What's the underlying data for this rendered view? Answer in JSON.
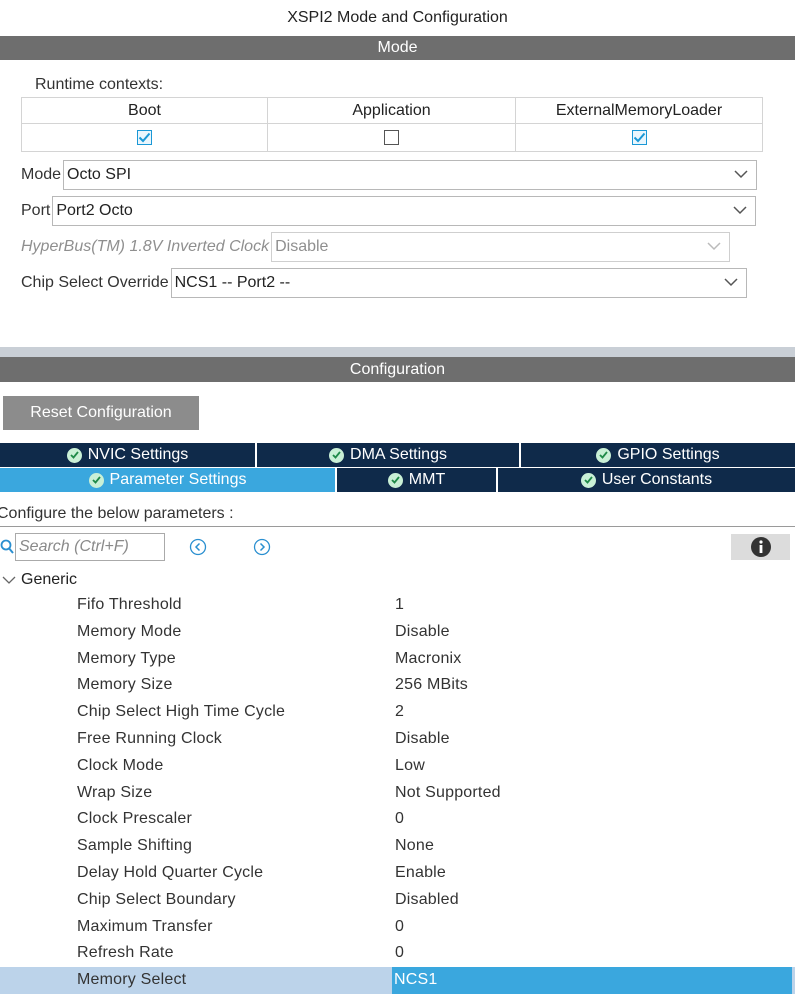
{
  "window_title": "XSPI2 Mode and Configuration",
  "mode_section": {
    "header": "Mode",
    "runtime_contexts_label": "Runtime contexts:",
    "contexts": [
      {
        "label": "Boot",
        "checked": true
      },
      {
        "label": "Application",
        "checked": false
      },
      {
        "label": "ExternalMemoryLoader",
        "checked": true
      }
    ],
    "fields": [
      {
        "label": "Mode",
        "value": "Octo SPI",
        "disabled": false
      },
      {
        "label": "Port",
        "value": "Port2 Octo",
        "disabled": false
      },
      {
        "label": "HyperBus(TM) 1.8V Inverted Clock",
        "value": "Disable",
        "disabled": true
      },
      {
        "label": "Chip Select Override",
        "value": "NCS1 -- Port2 --",
        "disabled": false
      }
    ]
  },
  "config_section": {
    "header": "Configuration",
    "reset_button": "Reset Configuration",
    "tabs_row1": [
      {
        "label": "NVIC Settings"
      },
      {
        "label": "DMA Settings"
      },
      {
        "label": "GPIO Settings"
      }
    ],
    "tabs_row2": [
      {
        "label": "Parameter Settings",
        "active": true
      },
      {
        "label": "MMT"
      },
      {
        "label": "User Constants"
      }
    ],
    "instruction": "Configure the below parameters :",
    "search_placeholder": "Search (Ctrl+F)",
    "group_label": "Generic",
    "parameters": [
      {
        "name": "Fifo Threshold",
        "value": "1"
      },
      {
        "name": "Memory Mode",
        "value": "Disable"
      },
      {
        "name": "Memory Type",
        "value": "Macronix"
      },
      {
        "name": "Memory Size",
        "value": "256 MBits"
      },
      {
        "name": "Chip Select High Time Cycle",
        "value": "2"
      },
      {
        "name": "Free Running Clock",
        "value": "Disable"
      },
      {
        "name": "Clock Mode",
        "value": "Low"
      },
      {
        "name": "Wrap Size",
        "value": "Not Supported"
      },
      {
        "name": "Clock Prescaler",
        "value": "0"
      },
      {
        "name": "Sample Shifting",
        "value": "None"
      },
      {
        "name": "Delay Hold Quarter Cycle",
        "value": "Enable"
      },
      {
        "name": "Chip Select Boundary",
        "value": "Disabled"
      },
      {
        "name": "Maximum Transfer",
        "value": "0"
      },
      {
        "name": "Refresh Rate",
        "value": "0"
      },
      {
        "name": "Memory Select",
        "value": "NCS1",
        "selected": true
      }
    ]
  },
  "colors": {
    "section_header": "#6e6e6e",
    "tab_bar": "#0f2a4a",
    "tab_active": "#3aa7de",
    "checkbox_check": "#1a98d6",
    "selected_row": "#bcd3ea"
  },
  "icons": {
    "check": "check-icon",
    "dropdown": "chevron-down-icon",
    "tab_status": "status-ok-icon",
    "search": "search-icon",
    "prev": "previous-icon",
    "next": "next-icon",
    "info": "info-icon",
    "group_toggle": "chevron-down-icon"
  }
}
